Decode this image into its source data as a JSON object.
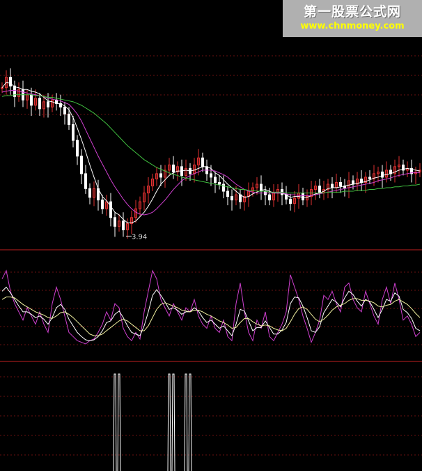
{
  "watermark": {
    "title": "第一股票公式网",
    "url": "www.chnmoney.com"
  },
  "price_panel": {
    "low_label": "3.94",
    "colors": {
      "up": "#e03030",
      "down": "#ffffff",
      "ma_fast": "#ffffff",
      "ma_mid": "#d040d0",
      "ma_slow": "#40c040",
      "divider": "#c02020",
      "grid": "#6a1010"
    }
  },
  "chart_data": [
    {
      "type": "candlestick",
      "panel": "price",
      "x": [
        0,
        1,
        2,
        3,
        4,
        5,
        6,
        7,
        8,
        9,
        10,
        11,
        12,
        13,
        14,
        15,
        16,
        17,
        18,
        19,
        20,
        21,
        22,
        23,
        24,
        25,
        26,
        27,
        28,
        29,
        30,
        31,
        32,
        33,
        34,
        35,
        36,
        37,
        38,
        39,
        40,
        41,
        42,
        43,
        44,
        45,
        46,
        47,
        48,
        49,
        50,
        51,
        52,
        53,
        54,
        55,
        56,
        57,
        58,
        59,
        60,
        61,
        62,
        63,
        64,
        65,
        66,
        67,
        68,
        69,
        70,
        71,
        72,
        73,
        74,
        75,
        76,
        77,
        78,
        79,
        80,
        81,
        82,
        83,
        84,
        85,
        86,
        87,
        88,
        89,
        90,
        91,
        92,
        93,
        94,
        95,
        96,
        97,
        98,
        99,
        100
      ],
      "close": [
        5.6,
        5.72,
        5.62,
        5.5,
        5.58,
        5.46,
        5.52,
        5.4,
        5.48,
        5.36,
        5.44,
        5.38,
        5.46,
        5.42,
        5.38,
        5.3,
        5.18,
        5.0,
        4.82,
        4.62,
        4.45,
        4.35,
        4.45,
        4.32,
        4.22,
        4.3,
        4.12,
        4.02,
        4.08,
        3.98,
        4.05,
        4.12,
        4.22,
        4.3,
        4.4,
        4.48,
        4.56,
        4.62,
        4.58,
        4.66,
        4.72,
        4.64,
        4.7,
        4.6,
        4.68,
        4.62,
        4.72,
        4.8,
        4.7,
        4.62,
        4.58,
        4.52,
        4.5,
        4.42,
        4.36,
        4.32,
        4.38,
        4.3,
        4.36,
        4.42,
        4.46,
        4.5,
        4.42,
        4.38,
        4.32,
        4.4,
        4.44,
        4.38,
        4.33,
        4.28,
        4.34,
        4.4,
        4.32,
        4.36,
        4.44,
        4.48,
        4.4,
        4.44,
        4.5,
        4.46,
        4.52,
        4.48,
        4.46,
        4.54,
        4.5,
        4.56,
        4.52,
        4.58,
        4.56,
        4.62,
        4.64,
        4.58,
        4.66,
        4.62,
        4.7,
        4.72,
        4.66,
        4.68,
        4.62,
        4.64,
        4.66
      ],
      "ma_window_labels": [],
      "series": [
        {
          "color": "#ffffff",
          "values": [
            5.6,
            5.66,
            5.65,
            5.61,
            5.6,
            5.58,
            5.58,
            5.56,
            5.55,
            5.53,
            5.49,
            5.45,
            5.44,
            5.42,
            5.42,
            5.39,
            5.35,
            5.26,
            5.14,
            5.01,
            4.87,
            4.72,
            4.58,
            4.45,
            4.36,
            4.31,
            4.25,
            4.18,
            4.15,
            4.1,
            4.06,
            4.06,
            4.08,
            4.13,
            4.18,
            4.25,
            4.33,
            4.42,
            4.5,
            4.55,
            4.6,
            4.63,
            4.65,
            4.65,
            4.66,
            4.65,
            4.66,
            4.68,
            4.7,
            4.7,
            4.68,
            4.63,
            4.6,
            4.55,
            4.5,
            4.46,
            4.42,
            4.38,
            4.35,
            4.36,
            4.39,
            4.41,
            4.43,
            4.44,
            4.42,
            4.4,
            4.4,
            4.4,
            4.38,
            4.35,
            4.36,
            4.36,
            4.35,
            4.35,
            4.37,
            4.39,
            4.4,
            4.42,
            4.45,
            4.46,
            4.46,
            4.47,
            4.48,
            4.49,
            4.5,
            4.51,
            4.52,
            4.53,
            4.55,
            4.57,
            4.58,
            4.6,
            4.61,
            4.62,
            4.64,
            4.66,
            4.67,
            4.68,
            4.67,
            4.66,
            4.65
          ]
        },
        {
          "color": "#d040d0",
          "values": [
            5.55,
            5.56,
            5.57,
            5.57,
            5.56,
            5.55,
            5.54,
            5.53,
            5.52,
            5.51,
            5.5,
            5.48,
            5.47,
            5.46,
            5.45,
            5.43,
            5.41,
            5.36,
            5.3,
            5.22,
            5.12,
            5.02,
            4.92,
            4.82,
            4.73,
            4.64,
            4.55,
            4.47,
            4.4,
            4.33,
            4.27,
            4.22,
            4.18,
            4.16,
            4.15,
            4.16,
            4.18,
            4.22,
            4.27,
            4.32,
            4.38,
            4.44,
            4.49,
            4.54,
            4.57,
            4.6,
            4.62,
            4.64,
            4.66,
            4.66,
            4.66,
            4.65,
            4.63,
            4.61,
            4.58,
            4.54,
            4.5,
            4.47,
            4.44,
            4.42,
            4.41,
            4.4,
            4.4,
            4.4,
            4.4,
            4.4,
            4.4,
            4.4,
            4.39,
            4.38,
            4.38,
            4.37,
            4.37,
            4.37,
            4.37,
            4.38,
            4.39,
            4.4,
            4.41,
            4.42,
            4.43,
            4.44,
            4.45,
            4.46,
            4.47,
            4.48,
            4.49,
            4.5,
            4.51,
            4.52,
            4.54,
            4.55,
            4.56,
            4.57,
            4.59,
            4.6,
            4.61,
            4.62,
            4.63,
            4.63,
            4.63
          ]
        },
        {
          "color": "#40c040",
          "values": [
            5.5,
            5.51,
            5.51,
            5.52,
            5.52,
            5.52,
            5.52,
            5.52,
            5.51,
            5.51,
            5.5,
            5.49,
            5.49,
            5.48,
            5.47,
            5.46,
            5.45,
            5.44,
            5.42,
            5.4,
            5.37,
            5.34,
            5.31,
            5.27,
            5.23,
            5.19,
            5.14,
            5.09,
            5.04,
            4.99,
            4.94,
            4.9,
            4.86,
            4.82,
            4.78,
            4.75,
            4.72,
            4.69,
            4.67,
            4.65,
            4.63,
            4.61,
            4.6,
            4.58,
            4.57,
            4.56,
            4.55,
            4.54,
            4.53,
            4.52,
            4.51,
            4.5,
            4.49,
            4.48,
            4.47,
            4.46,
            4.45,
            4.44,
            4.44,
            4.43,
            4.43,
            4.42,
            4.42,
            4.42,
            4.41,
            4.41,
            4.41,
            4.41,
            4.4,
            4.4,
            4.4,
            4.4,
            4.4,
            4.4,
            4.4,
            4.4,
            4.4,
            4.4,
            4.41,
            4.41,
            4.41,
            4.41,
            4.42,
            4.42,
            4.42,
            4.43,
            4.43,
            4.43,
            4.44,
            4.44,
            4.45,
            4.45,
            4.46,
            4.46,
            4.47,
            4.47,
            4.48,
            4.48,
            4.49,
            4.49,
            4.5
          ]
        }
      ],
      "ylim": [
        3.8,
        5.9
      ],
      "annotations": [
        {
          "x": 29,
          "y": 3.94,
          "text": "3.94"
        }
      ]
    },
    {
      "type": "line",
      "panel": "oscillator",
      "x": [
        0,
        1,
        2,
        3,
        4,
        5,
        6,
        7,
        8,
        9,
        10,
        11,
        12,
        13,
        14,
        15,
        16,
        17,
        18,
        19,
        20,
        21,
        22,
        23,
        24,
        25,
        26,
        27,
        28,
        29,
        30,
        31,
        32,
        33,
        34,
        35,
        36,
        37,
        38,
        39,
        40,
        41,
        42,
        43,
        44,
        45,
        46,
        47,
        48,
        49,
        50,
        51,
        52,
        53,
        54,
        55,
        56,
        57,
        58,
        59,
        60,
        61,
        62,
        63,
        64,
        65,
        66,
        67,
        68,
        69,
        70,
        71,
        72,
        73,
        74,
        75,
        76,
        77,
        78,
        79,
        80,
        81,
        82,
        83,
        84,
        85,
        86,
        87,
        88,
        89,
        90,
        91,
        92,
        93,
        94,
        95,
        96,
        97,
        98,
        99,
        100
      ],
      "series": [
        {
          "color": "#d040d0",
          "values": [
            85,
            95,
            70,
            55,
            45,
            35,
            50,
            40,
            30,
            45,
            30,
            20,
            55,
            75,
            60,
            40,
            20,
            15,
            10,
            8,
            6,
            10,
            12,
            20,
            30,
            45,
            35,
            55,
            50,
            25,
            15,
            10,
            20,
            12,
            45,
            70,
            95,
            85,
            60,
            50,
            40,
            55,
            45,
            35,
            50,
            45,
            60,
            40,
            30,
            25,
            40,
            25,
            20,
            35,
            15,
            10,
            55,
            80,
            45,
            20,
            10,
            35,
            25,
            45,
            15,
            10,
            20,
            30,
            45,
            90,
            75,
            60,
            40,
            25,
            8,
            20,
            35,
            65,
            60,
            70,
            55,
            45,
            75,
            80,
            60,
            50,
            45,
            70,
            55,
            40,
            30,
            60,
            75,
            55,
            80,
            60,
            35,
            40,
            30,
            15,
            20
          ]
        },
        {
          "color": "#ffffff",
          "values": [
            70,
            75,
            68,
            60,
            52,
            45,
            45,
            42,
            38,
            40,
            36,
            30,
            38,
            50,
            54,
            48,
            36,
            28,
            20,
            15,
            11,
            10,
            11,
            15,
            22,
            32,
            34,
            42,
            46,
            38,
            28,
            20,
            18,
            16,
            28,
            45,
            65,
            72,
            65,
            57,
            48,
            50,
            47,
            42,
            45,
            45,
            50,
            46,
            38,
            32,
            35,
            30,
            25,
            28,
            22,
            16,
            30,
            48,
            46,
            34,
            22,
            26,
            26,
            34,
            26,
            18,
            18,
            23,
            32,
            55,
            63,
            62,
            52,
            38,
            22,
            20,
            27,
            44,
            52,
            60,
            57,
            51,
            62,
            70,
            66,
            58,
            52,
            60,
            57,
            48,
            38,
            48,
            60,
            58,
            68,
            64,
            48,
            44,
            37,
            25,
            22
          ]
        },
        {
          "color": "#f0f0a0",
          "values": [
            60,
            63,
            63,
            62,
            58,
            54,
            51,
            48,
            45,
            43,
            41,
            38,
            37,
            40,
            44,
            45,
            42,
            38,
            33,
            28,
            23,
            18,
            16,
            16,
            18,
            22,
            26,
            30,
            34,
            36,
            34,
            30,
            26,
            22,
            22,
            28,
            38,
            48,
            54,
            56,
            54,
            52,
            50,
            47,
            46,
            45,
            47,
            47,
            45,
            42,
            40,
            37,
            34,
            32,
            29,
            25,
            26,
            32,
            37,
            37,
            33,
            30,
            28,
            29,
            28,
            25,
            23,
            22,
            25,
            33,
            42,
            49,
            51,
            48,
            42,
            36,
            33,
            36,
            41,
            47,
            51,
            53,
            55,
            59,
            61,
            61,
            59,
            59,
            58,
            56,
            52,
            51,
            53,
            54,
            58,
            60,
            57,
            54,
            49,
            43,
            38
          ]
        }
      ],
      "ylim": [
        0,
        100
      ]
    },
    {
      "type": "bar",
      "panel": "signal",
      "x": [
        27,
        28,
        40,
        41,
        44,
        45
      ],
      "values": [
        1,
        1,
        1,
        1,
        1,
        1
      ],
      "ylim": [
        0,
        1
      ]
    }
  ]
}
